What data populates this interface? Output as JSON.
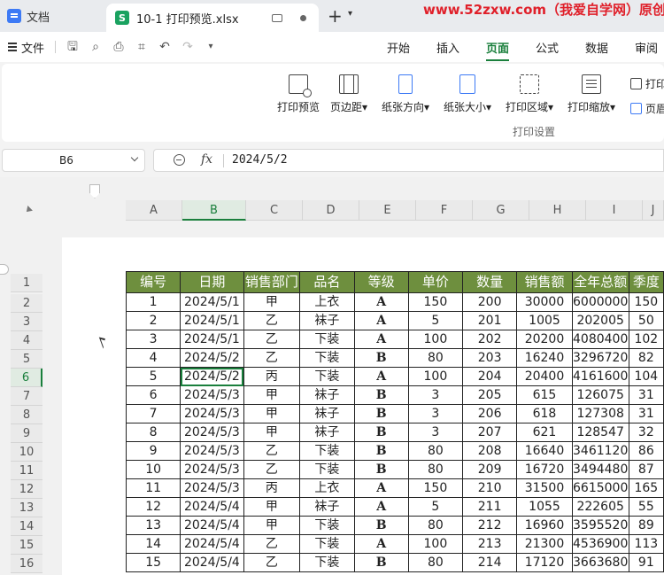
{
  "tabs": {
    "docs_label": "文档",
    "file_tab": "10-1 打印预览.xlsx",
    "file_icon_letter": "S"
  },
  "watermark": "www.52zxw.com（我爱自学网）原创",
  "menu": {
    "file_label": "文件",
    "tabs": [
      "开始",
      "插入",
      "页面",
      "公式",
      "数据",
      "审阅"
    ],
    "active_tab": "页面"
  },
  "ribbon": {
    "buttons": [
      "打印预览",
      "页边距▾",
      "纸张方向▾",
      "纸张大小▾",
      "打印区域▾",
      "打印缩放▾"
    ],
    "small_buttons": [
      "打印",
      "页眉"
    ],
    "group_label": "打印设置"
  },
  "formula_bar": {
    "name_box": "B6",
    "fx_label": "fx",
    "value": "2024/5/2"
  },
  "sheet": {
    "columns": [
      "A",
      "B",
      "C",
      "D",
      "E",
      "F",
      "G",
      "H",
      "I",
      "J"
    ],
    "active_column": "B",
    "row_numbers": [
      "1",
      "2",
      "3",
      "4",
      "5",
      "6",
      "7",
      "8",
      "9",
      "10",
      "11",
      "12",
      "13",
      "14",
      "15",
      "16"
    ],
    "active_row": "6",
    "header": [
      "编号",
      "日期",
      "销售部门",
      "品名",
      "等级",
      "单价",
      "数量",
      "销售额",
      "全年总额",
      "季度"
    ],
    "rows": [
      [
        "1",
        "2024/5/1",
        "甲",
        "上衣",
        "A",
        "150",
        "200",
        "30000",
        "6000000",
        "150"
      ],
      [
        "2",
        "2024/5/1",
        "乙",
        "袜子",
        "A",
        "5",
        "201",
        "1005",
        "202005",
        "50"
      ],
      [
        "3",
        "2024/5/1",
        "乙",
        "下装",
        "A",
        "100",
        "202",
        "20200",
        "4080400",
        "102"
      ],
      [
        "4",
        "2024/5/2",
        "乙",
        "下装",
        "B",
        "80",
        "203",
        "16240",
        "3296720",
        "82"
      ],
      [
        "5",
        "2024/5/2",
        "丙",
        "下装",
        "A",
        "100",
        "204",
        "20400",
        "4161600",
        "104"
      ],
      [
        "6",
        "2024/5/3",
        "甲",
        "袜子",
        "B",
        "3",
        "205",
        "615",
        "126075",
        "31"
      ],
      [
        "7",
        "2024/5/3",
        "甲",
        "袜子",
        "B",
        "3",
        "206",
        "618",
        "127308",
        "31"
      ],
      [
        "8",
        "2024/5/3",
        "甲",
        "袜子",
        "B",
        "3",
        "207",
        "621",
        "128547",
        "32"
      ],
      [
        "9",
        "2024/5/3",
        "乙",
        "下装",
        "B",
        "80",
        "208",
        "16640",
        "3461120",
        "86"
      ],
      [
        "10",
        "2024/5/3",
        "乙",
        "下装",
        "B",
        "80",
        "209",
        "16720",
        "3494480",
        "87"
      ],
      [
        "11",
        "2024/5/3",
        "丙",
        "上衣",
        "A",
        "150",
        "210",
        "31500",
        "6615000",
        "165"
      ],
      [
        "12",
        "2024/5/4",
        "甲",
        "袜子",
        "A",
        "5",
        "211",
        "1055",
        "222605",
        "55"
      ],
      [
        "13",
        "2024/5/4",
        "甲",
        "下装",
        "B",
        "80",
        "212",
        "16960",
        "3595520",
        "89"
      ],
      [
        "14",
        "2024/5/4",
        "乙",
        "下装",
        "A",
        "100",
        "213",
        "21300",
        "4536900",
        "113"
      ],
      [
        "15",
        "2024/5/4",
        "乙",
        "下装",
        "B",
        "80",
        "214",
        "17120",
        "3663680",
        "91"
      ]
    ],
    "selected_cell": "B6"
  }
}
